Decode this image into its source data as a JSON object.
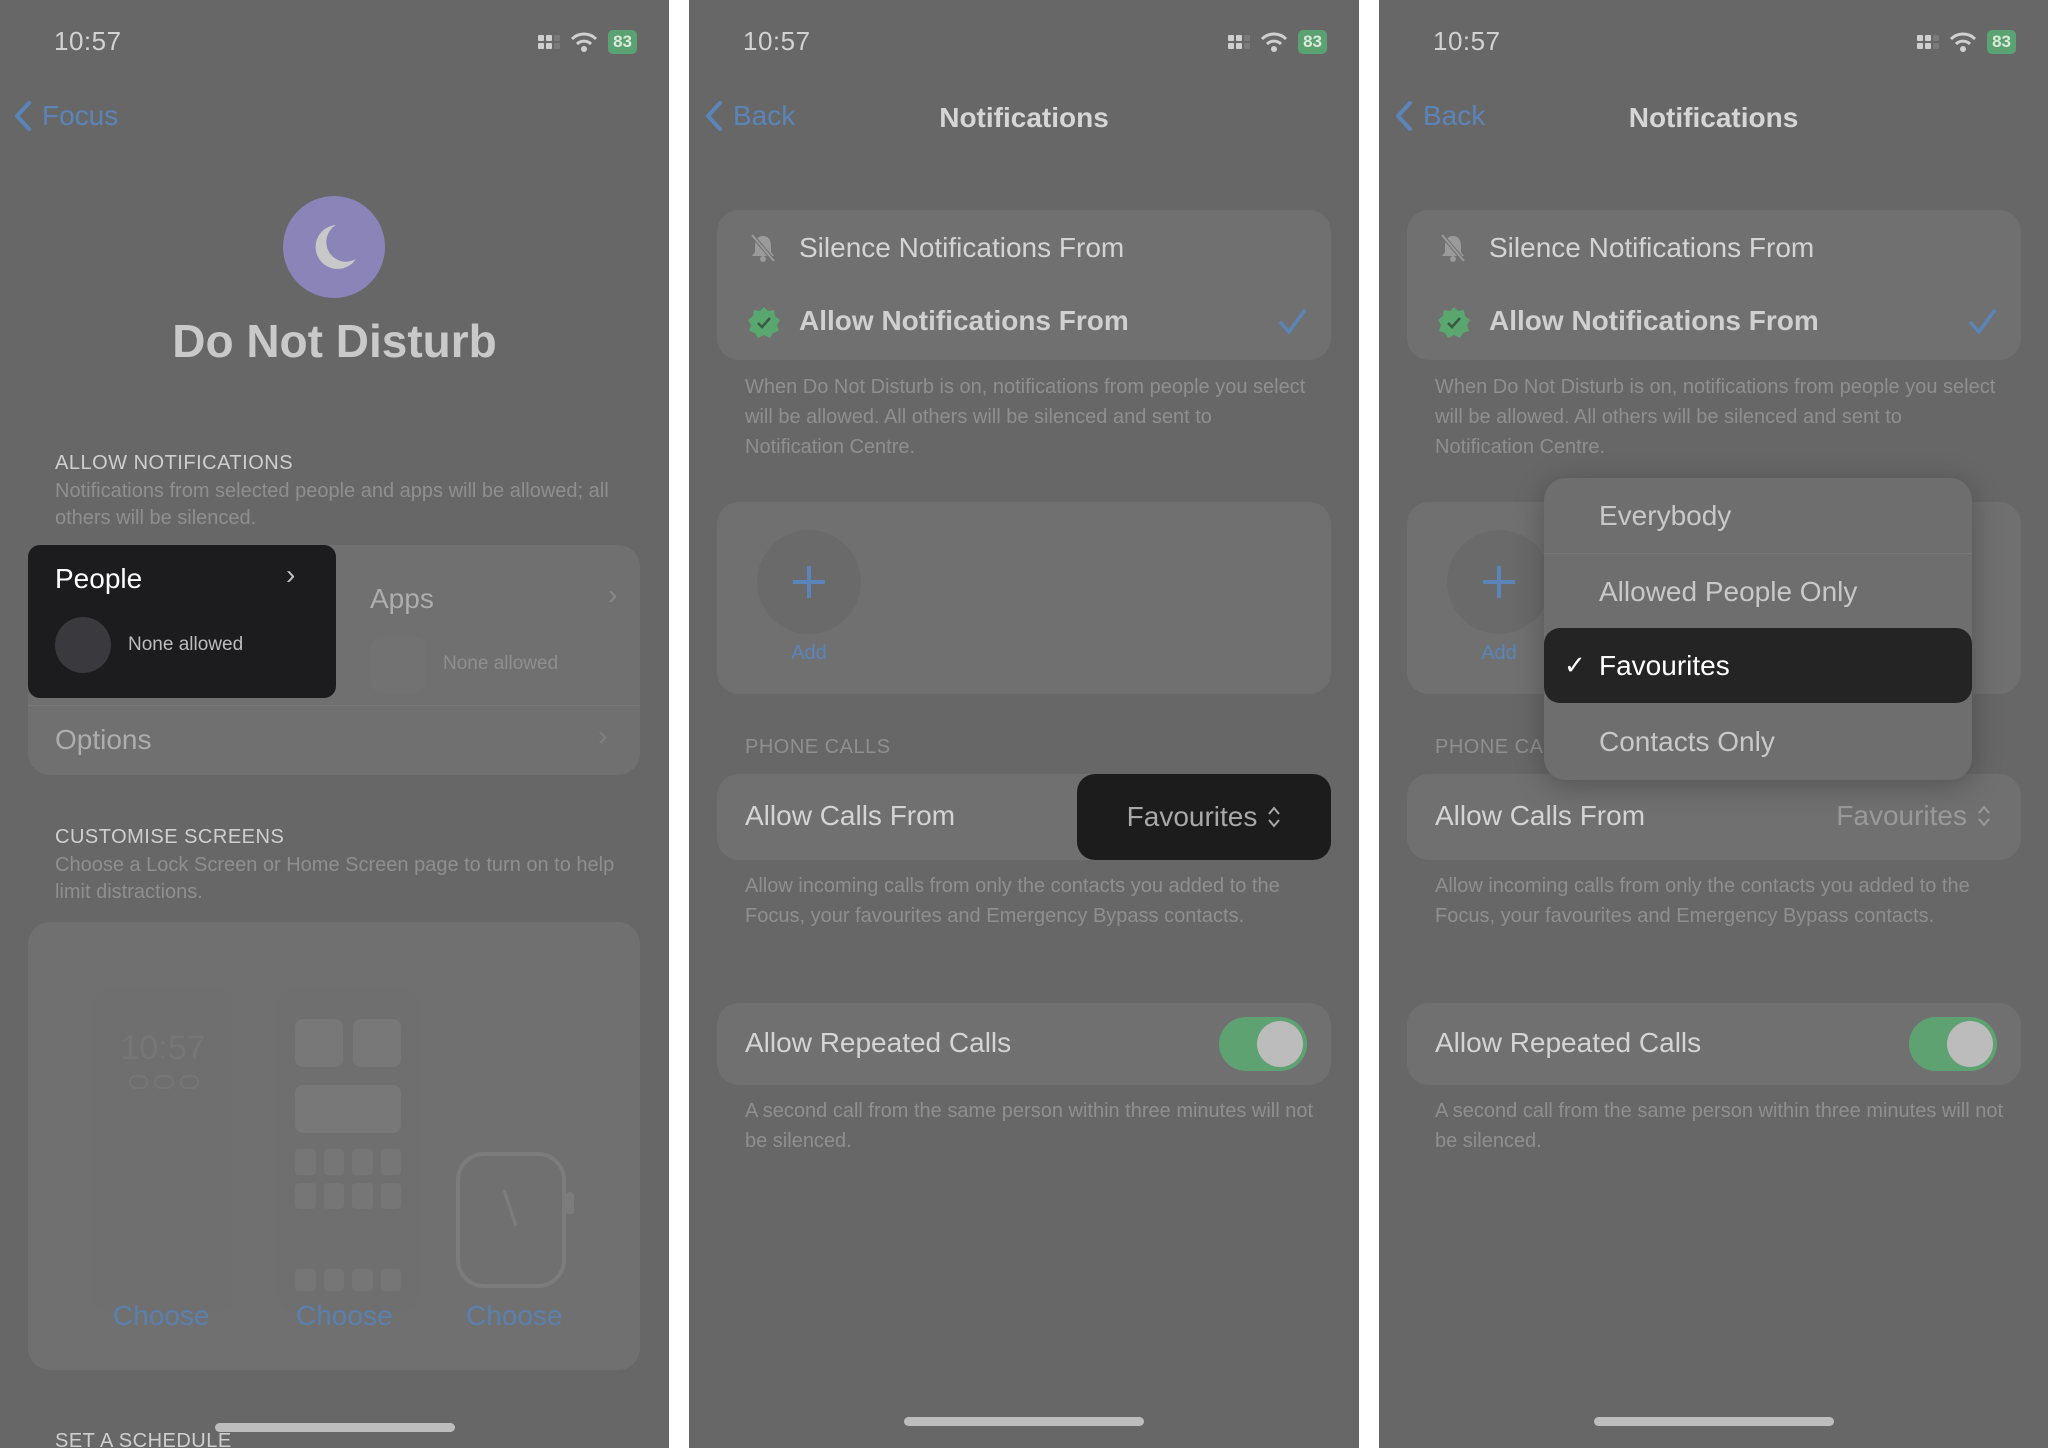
{
  "colors": {
    "background": "#676767",
    "accent_blue": "#5b85b9",
    "toggle_green": "#5ea272",
    "highlight_dark": "#1c1c1e",
    "dnd_purple": "#8a84b9",
    "battery_green": "#5aa272"
  },
  "status_bar": {
    "time": "10:57",
    "battery": "83"
  },
  "panel1": {
    "back_label": "Focus",
    "focus_icon": "moon-icon",
    "title": "Do Not Disturb",
    "allow_notifications": {
      "header": "ALLOW NOTIFICATIONS",
      "description": "Notifications from selected people and apps will be allowed; all others will be silenced.",
      "people_label": "People",
      "people_value": "None allowed",
      "apps_label": "Apps",
      "apps_value": "None allowed",
      "options_label": "Options"
    },
    "customise_screens": {
      "header": "CUSTOMISE SCREENS",
      "description": "Choose a Lock Screen or Home Screen page to turn on to help limit distractions.",
      "lock_preview_time": "10:57",
      "choose_labels": [
        "Choose",
        "Choose",
        "Choose"
      ]
    },
    "next_header": "SET A SCHEDULE"
  },
  "notifications_screen": {
    "back_label": "Back",
    "title": "Notifications",
    "mode_options": [
      {
        "label": "Silence Notifications From",
        "icon": "bell-slash-icon",
        "selected": false
      },
      {
        "label": "Allow Notifications From",
        "icon": "verified-badge-icon",
        "selected": true
      }
    ],
    "mode_description": "When Do Not Disturb is on, notifications from people you select will be allowed. All others will be silenced and sent to Notification Centre.",
    "add_label": "Add",
    "phone_calls_header": "PHONE CALLS",
    "allow_calls_label": "Allow Calls From",
    "allow_calls_value": "Favourites",
    "allow_calls_description": "Allow incoming calls from only the contacts you added to the Focus, your favourites and Emergency Bypass contacts.",
    "repeated_calls_label": "Allow Repeated Calls",
    "repeated_calls_on": true,
    "repeated_calls_description": "A second call from the same person within three minutes will not be silenced."
  },
  "panel3_menu": {
    "phone_calls_header_truncated": "PHONE CA",
    "items": [
      {
        "label": "Everybody",
        "selected": false
      },
      {
        "label": "Allowed People Only",
        "selected": false
      },
      {
        "label": "Favourites",
        "selected": true
      },
      {
        "label": "Contacts Only",
        "selected": false
      }
    ],
    "checkmark": "✓"
  }
}
